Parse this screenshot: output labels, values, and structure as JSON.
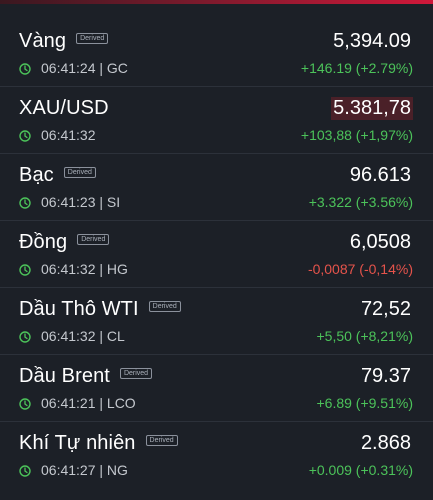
{
  "colors": {
    "up": "#4cc35a",
    "down": "#e5534b",
    "clock_icon": "#4cc35a",
    "accent_bar": "#d0183a",
    "background": "#1c2027"
  },
  "badge_label": "Derived",
  "items": [
    {
      "name": "Vàng",
      "derived": true,
      "time_symbol": "06:41:24 | GC",
      "price": "5,394.09",
      "change": "+146.19 (+2.79%)",
      "direction": "up",
      "highlight": false
    },
    {
      "name": "XAU/USD",
      "derived": false,
      "time_symbol": "06:41:32",
      "price": "5.381,78",
      "change": "+103,88 (+1,97%)",
      "direction": "up",
      "highlight": true
    },
    {
      "name": "Bạc",
      "derived": true,
      "time_symbol": "06:41:23 | SI",
      "price": "96.613",
      "change": "+3.322 (+3.56%)",
      "direction": "up",
      "highlight": false
    },
    {
      "name": "Đồng",
      "derived": true,
      "time_symbol": "06:41:32 | HG",
      "price": "6,0508",
      "change": "-0,0087 (-0,14%)",
      "direction": "down",
      "highlight": false
    },
    {
      "name": "Dầu Thô WTI",
      "derived": true,
      "time_symbol": "06:41:32 | CL",
      "price": "72,52",
      "change": "+5,50 (+8,21%)",
      "direction": "up",
      "highlight": false
    },
    {
      "name": "Dầu Brent",
      "derived": true,
      "time_symbol": "06:41:21 | LCO",
      "price": "79.37",
      "change": "+6.89 (+9.51%)",
      "direction": "up",
      "highlight": false
    },
    {
      "name": "Khí Tự nhiên",
      "derived": true,
      "time_symbol": "06:41:27 | NG",
      "price": "2.868",
      "change": "+0.009 (+0.31%)",
      "direction": "up",
      "highlight": false
    }
  ]
}
